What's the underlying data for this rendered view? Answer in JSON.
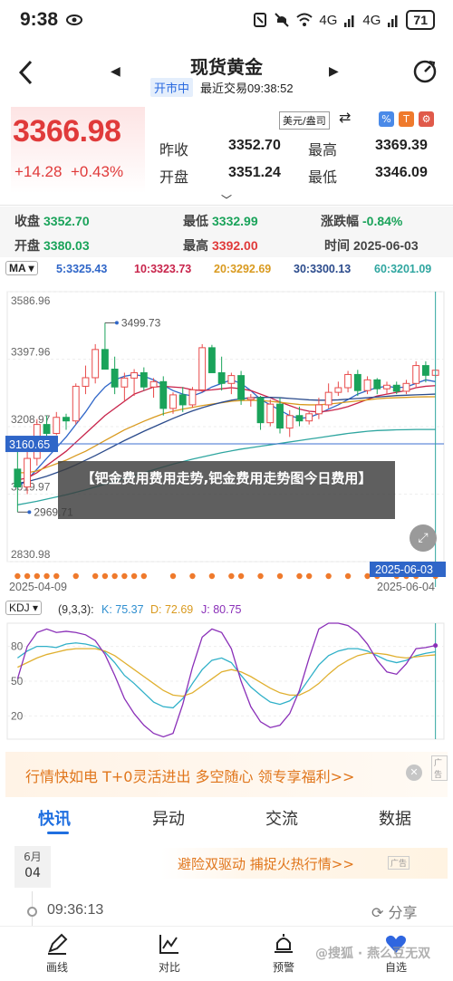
{
  "status_bar": {
    "time": "9:38",
    "signal_4g": "4G",
    "signal_4g2": "4G",
    "battery": "71"
  },
  "nav": {
    "title": "现货黄金",
    "market_status": "开市中",
    "last_trade": "最近交易09:38:52"
  },
  "quote": {
    "price": "3366.98",
    "change": "+14.28",
    "change_pct": "+0.43%",
    "unit_select": "美元/盎司",
    "prev_close_label": "昨收",
    "prev_close": "3352.70",
    "high_label": "最高",
    "high": "3369.39",
    "open_label": "开盘",
    "open": "3351.24",
    "low_label": "最低",
    "low": "3346.09",
    "tool_a": "%",
    "tool_b": "T",
    "tool_c": "⚙"
  },
  "stats": {
    "close_label": "收盘",
    "close": "3352.70",
    "low_label": "最低",
    "low": "3332.99",
    "chg_label": "涨跌幅",
    "chg": "-0.84%",
    "open_label": "开盘",
    "open": "3380.03",
    "high_label": "最高",
    "high": "3392.00",
    "time_label": "时间",
    "time": "2025-06-03"
  },
  "ma_bar": {
    "selector": "MA ▾",
    "ma5": "5:3325.43",
    "ma10": "10:3323.73",
    "ma20": "20:3292.69",
    "ma30": "30:3300.13",
    "ma60": "60:3201.09",
    "colors": {
      "ma5": "#2f66c8",
      "ma10": "#c8244b",
      "ma20": "#d99a1f",
      "ma30": "#2b4b8c",
      "ma60": "#2fa6a0"
    }
  },
  "chart_data": [
    {
      "type": "candlestick",
      "y_ticks": [
        "3586.96",
        "3397.96",
        "3208.97",
        "3019.97",
        "2830.98"
      ],
      "ylim": [
        2830.98,
        3586.96
      ],
      "crosshair_value": "3160.65",
      "crosshair_date": "2025-06-03",
      "max_label": "3499.73",
      "min_label": "2969.71",
      "x_labels": [
        "2025-04-09",
        "2025-06-04"
      ],
      "candles": [
        {
          "o": 3090,
          "h": 3168,
          "l": 2969.71,
          "c": 3040
        },
        {
          "o": 3040,
          "h": 3150,
          "l": 3020,
          "c": 3120
        },
        {
          "o": 3120,
          "h": 3230,
          "l": 3100,
          "c": 3215
        },
        {
          "o": 3215,
          "h": 3240,
          "l": 3170,
          "c": 3190
        },
        {
          "o": 3190,
          "h": 3250,
          "l": 3185,
          "c": 3235
        },
        {
          "o": 3235,
          "h": 3245,
          "l": 3200,
          "c": 3225
        },
        {
          "o": 3225,
          "h": 3330,
          "l": 3215,
          "c": 3322
        },
        {
          "o": 3322,
          "h": 3380,
          "l": 3300,
          "c": 3346
        },
        {
          "o": 3346,
          "h": 3440,
          "l": 3330,
          "c": 3425
        },
        {
          "o": 3425,
          "h": 3499.73,
          "l": 3370,
          "c": 3370
        },
        {
          "o": 3370,
          "h": 3405,
          "l": 3300,
          "c": 3320
        },
        {
          "o": 3320,
          "h": 3360,
          "l": 3280,
          "c": 3345
        },
        {
          "o": 3345,
          "h": 3370,
          "l": 3295,
          "c": 3360
        },
        {
          "o": 3360,
          "h": 3375,
          "l": 3310,
          "c": 3320
        },
        {
          "o": 3320,
          "h": 3345,
          "l": 3290,
          "c": 3335
        },
        {
          "o": 3335,
          "h": 3350,
          "l": 3240,
          "c": 3260
        },
        {
          "o": 3260,
          "h": 3305,
          "l": 3245,
          "c": 3298
        },
        {
          "o": 3298,
          "h": 3320,
          "l": 3250,
          "c": 3270
        },
        {
          "o": 3270,
          "h": 3320,
          "l": 3262,
          "c": 3312
        },
        {
          "o": 3312,
          "h": 3440,
          "l": 3305,
          "c": 3430
        },
        {
          "o": 3430,
          "h": 3438,
          "l": 3360,
          "c": 3360
        },
        {
          "o": 3360,
          "h": 3405,
          "l": 3310,
          "c": 3330
        },
        {
          "o": 3330,
          "h": 3360,
          "l": 3300,
          "c": 3352
        },
        {
          "o": 3352,
          "h": 3365,
          "l": 3270,
          "c": 3285
        },
        {
          "o": 3285,
          "h": 3300,
          "l": 3265,
          "c": 3290
        },
        {
          "o": 3290,
          "h": 3295,
          "l": 3200,
          "c": 3220
        },
        {
          "o": 3220,
          "h": 3285,
          "l": 3210,
          "c": 3272
        },
        {
          "o": 3272,
          "h": 3290,
          "l": 3190,
          "c": 3205
        },
        {
          "o": 3205,
          "h": 3255,
          "l": 3180,
          "c": 3240
        },
        {
          "o": 3240,
          "h": 3265,
          "l": 3210,
          "c": 3225
        },
        {
          "o": 3225,
          "h": 3250,
          "l": 3215,
          "c": 3245
        },
        {
          "o": 3245,
          "h": 3290,
          "l": 3230,
          "c": 3270
        },
        {
          "o": 3270,
          "h": 3330,
          "l": 3260,
          "c": 3305
        },
        {
          "o": 3305,
          "h": 3335,
          "l": 3295,
          "c": 3318
        },
        {
          "o": 3318,
          "h": 3365,
          "l": 3305,
          "c": 3355
        },
        {
          "o": 3355,
          "h": 3368,
          "l": 3295,
          "c": 3310
        },
        {
          "o": 3310,
          "h": 3350,
          "l": 3300,
          "c": 3340
        },
        {
          "o": 3340,
          "h": 3345,
          "l": 3300,
          "c": 3315
        },
        {
          "o": 3315,
          "h": 3335,
          "l": 3300,
          "c": 3325
        },
        {
          "o": 3325,
          "h": 3335,
          "l": 3300,
          "c": 3308
        },
        {
          "o": 3308,
          "h": 3340,
          "l": 3300,
          "c": 3330
        },
        {
          "o": 3330,
          "h": 3392,
          "l": 3320,
          "c": 3380
        },
        {
          "o": 3380,
          "h": 3392,
          "l": 3332.99,
          "c": 3352.7
        },
        {
          "o": 3352.7,
          "h": 3369.39,
          "l": 3346.09,
          "c": 3366.98
        }
      ],
      "ma_lines": {
        "ma5": [
          3040,
          3060,
          3090,
          3120,
          3150,
          3180,
          3215,
          3250,
          3290,
          3320,
          3340,
          3350,
          3355,
          3350,
          3340,
          3325,
          3310,
          3300,
          3295,
          3305,
          3320,
          3330,
          3340,
          3330,
          3310,
          3285,
          3270,
          3255,
          3240,
          3232,
          3235,
          3245,
          3258,
          3270,
          3285,
          3300,
          3310,
          3318,
          3322,
          3318,
          3320,
          3330,
          3340,
          3335
        ],
        "ma10": [
          3060,
          3065,
          3080,
          3100,
          3120,
          3140,
          3165,
          3190,
          3215,
          3240,
          3260,
          3280,
          3300,
          3310,
          3320,
          3322,
          3320,
          3318,
          3312,
          3310,
          3312,
          3315,
          3318,
          3315,
          3310,
          3300,
          3290,
          3278,
          3268,
          3258,
          3252,
          3250,
          3253,
          3258,
          3265,
          3275,
          3285,
          3295,
          3300,
          3305,
          3310,
          3318,
          3322,
          3323.73
        ],
        "ma20": [
          3080,
          3080,
          3085,
          3095,
          3105,
          3115,
          3128,
          3140,
          3155,
          3170,
          3185,
          3200,
          3212,
          3224,
          3235,
          3245,
          3252,
          3258,
          3263,
          3268,
          3272,
          3276,
          3280,
          3282,
          3283,
          3282,
          3280,
          3277,
          3274,
          3271,
          3270,
          3270,
          3272,
          3275,
          3278,
          3281,
          3284,
          3287,
          3289,
          3290,
          3291,
          3292,
          3292.5,
          3292.69
        ],
        "ma30": [
          3050,
          3055,
          3062,
          3070,
          3080,
          3090,
          3102,
          3115,
          3128,
          3142,
          3156,
          3170,
          3183,
          3196,
          3208,
          3220,
          3232,
          3243,
          3253,
          3262,
          3270,
          3277,
          3283,
          3287,
          3290,
          3291,
          3291,
          3290,
          3288,
          3286,
          3284,
          3283,
          3283,
          3284,
          3286,
          3288,
          3290,
          3292,
          3294,
          3296,
          3297,
          3298,
          3299,
          3300.13
        ],
        "ma60": [
          2990,
          2995,
          3000,
          3006,
          3012,
          3018,
          3025,
          3032,
          3040,
          3048,
          3056,
          3064,
          3072,
          3080,
          3088,
          3096,
          3104,
          3111,
          3118,
          3124,
          3130,
          3136,
          3141,
          3146,
          3150,
          3154,
          3158,
          3162,
          3166,
          3170,
          3174,
          3178,
          3182,
          3186,
          3190,
          3193,
          3196,
          3198,
          3199,
          3200,
          3200.5,
          3201,
          3201,
          3201.09
        ]
      }
    },
    {
      "type": "line",
      "name": "KDJ",
      "params": "(9,3,3):",
      "k_label": "K: 75.37",
      "d_label": "D: 72.69",
      "j_label": "J: 80.75",
      "y_ticks": [
        "80",
        "50",
        "20"
      ],
      "ylim": [
        0,
        100
      ],
      "series": [
        {
          "name": "K",
          "values": [
            70,
            76,
            80,
            80,
            79,
            82,
            83,
            82,
            80,
            75,
            66,
            55,
            48,
            40,
            32,
            28,
            27,
            35,
            48,
            60,
            68,
            70,
            66,
            55,
            45,
            38,
            32,
            30,
            33,
            40,
            52,
            64,
            72,
            76,
            78,
            78,
            76,
            72,
            68,
            66,
            68,
            72,
            74,
            75.37
          ]
        },
        {
          "name": "D",
          "values": [
            62,
            66,
            70,
            73,
            75,
            77,
            78,
            78,
            78,
            76,
            72,
            66,
            60,
            54,
            48,
            42,
            38,
            37,
            40,
            46,
            52,
            58,
            60,
            58,
            54,
            49,
            44,
            40,
            38,
            38,
            42,
            48,
            56,
            63,
            68,
            72,
            74,
            74,
            73,
            71,
            70,
            71,
            72,
            72.69
          ]
        },
        {
          "name": "J",
          "values": [
            52,
            80,
            92,
            95,
            92,
            93,
            92,
            90,
            85,
            73,
            55,
            35,
            22,
            12,
            5,
            2,
            5,
            30,
            62,
            88,
            95,
            92,
            78,
            50,
            28,
            15,
            10,
            12,
            22,
            42,
            70,
            95,
            102,
            102,
            98,
            92,
            82,
            68,
            58,
            56,
            65,
            78,
            79,
            80.75
          ]
        }
      ]
    }
  ],
  "overlay": {
    "text": "【钯金费用费用走势,钯金费用走势图今日费用】"
  },
  "ad1": {
    "text": "行情快如电 T+0灵活进出 多空随心 领专享福利>>",
    "tag": "广告"
  },
  "tabs": [
    "快讯",
    "异动",
    "交流",
    "数据"
  ],
  "news": {
    "month": "6月",
    "day": "04",
    "ad_text": "避险双驱动 捕捉火热行情>>",
    "ad_tag": "广告",
    "time": "09:36:13",
    "share": "分享"
  },
  "bottom_nav": [
    {
      "label": "画线"
    },
    {
      "label": "对比"
    },
    {
      "label": "预警"
    },
    {
      "label": "自选"
    }
  ],
  "watermark": "@搜狐 · 燕么豆无双"
}
